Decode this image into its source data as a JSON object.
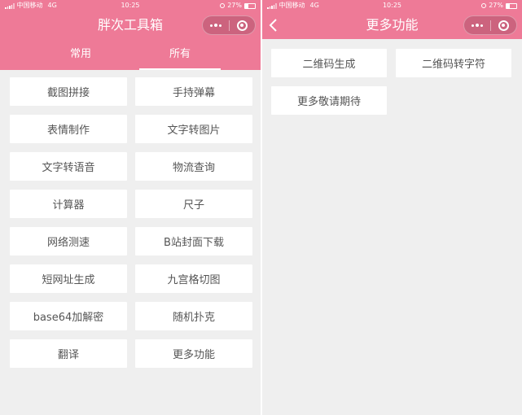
{
  "status_bar": {
    "carrier": "中国移动",
    "network": "4G",
    "time": "10:25",
    "battery": "27%"
  },
  "left_screen": {
    "title": "胖次工具箱",
    "tabs": [
      {
        "label": "常用"
      },
      {
        "label": "所有"
      }
    ],
    "active_tab": "所有",
    "tools": [
      {
        "label": "截图拼接"
      },
      {
        "label": "手持弹幕"
      },
      {
        "label": "表情制作"
      },
      {
        "label": "文字转图片"
      },
      {
        "label": "文字转语音"
      },
      {
        "label": "物流查询"
      },
      {
        "label": "计算器"
      },
      {
        "label": "尺子"
      },
      {
        "label": "网络测速"
      },
      {
        "label": "B站封面下载"
      },
      {
        "label": "短网址生成"
      },
      {
        "label": "九宫格切图"
      },
      {
        "label": "base64加解密"
      },
      {
        "label": "随机扑克"
      },
      {
        "label": "翻译"
      },
      {
        "label": "更多功能"
      }
    ]
  },
  "right_screen": {
    "title": "更多功能",
    "items": [
      {
        "label": "二维码生成"
      },
      {
        "label": "二维码转字符"
      },
      {
        "label": "更多敬请期待"
      }
    ]
  },
  "colors": {
    "brand": "#ee7a97",
    "background": "#efefef",
    "button": "#ffffff"
  }
}
